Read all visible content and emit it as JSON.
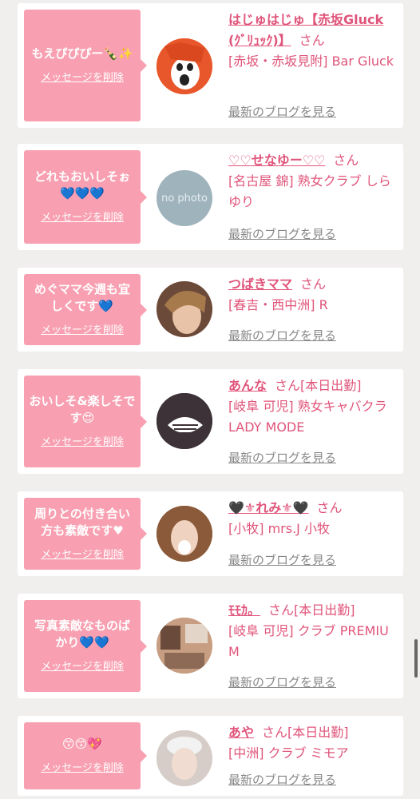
{
  "common": {
    "delete_label": "メッセージを削除",
    "blog_label": "最新のブログを見る",
    "san": "さん"
  },
  "cards": [
    {
      "message": "もえぴぴぴー🍾✨",
      "name": "はじゅはじゅ【赤坂Gluck(ｸﾞﾘｭｯｸ)】",
      "badge": "",
      "shop": "[赤坂・赤坂見附] Bar Gluck"
    },
    {
      "message": "どれもおいしそぉ💙💙💙",
      "name": "♡♡せなゆー♡♡",
      "badge": "",
      "shop": "[名古屋 錦] 熟女クラブ しらゆり",
      "avatar_text": "no photo"
    },
    {
      "message": "めぐママ今週も宜しくです💙",
      "name": "つばきママ",
      "badge": "",
      "shop": "[春吉・西中洲] R"
    },
    {
      "message": "おいしそ&楽しそです😍",
      "name": "あんな",
      "badge": "[本日出勤]",
      "shop": "[岐阜 可児] 熟女キャバクラ LADY MODE"
    },
    {
      "message": "周りとの付き合い方も素敵です♥",
      "name": "🖤⚜れみ⚜🖤",
      "badge": "",
      "shop": "[小牧] mrs.J 小牧"
    },
    {
      "message": "写真素敵なものばかり💙💙",
      "name": "ﾓﾓｶ。",
      "badge": "[本日出勤]",
      "shop": "[岐阜 可児] クラブ PREMIUM"
    },
    {
      "message": "😙😙💖",
      "name": "あや",
      "badge": "[本日出勤]",
      "shop": "[中洲] クラブ ミモア"
    }
  ]
}
